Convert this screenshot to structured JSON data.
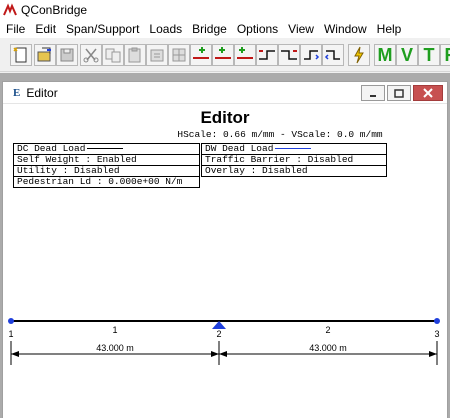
{
  "app": {
    "title": "QConBridge"
  },
  "menu": [
    "File",
    "Edit",
    "Span/Support",
    "Loads",
    "Bridge",
    "Options",
    "View",
    "Window",
    "Help"
  ],
  "toolbar": {
    "letters": [
      "M",
      "V",
      "T",
      "R"
    ]
  },
  "editor": {
    "window_title": "Editor",
    "heading": "Editor",
    "scale_text": "HScale: 0.66 m/mm - VScale: 0.0 m/mm",
    "legend_left": [
      "DC Dead Load",
      "Self Weight : Enabled",
      "Utility : Disabled",
      "Pedestrian Ld : 0.000e+00 N/m"
    ],
    "legend_right": [
      "DW Dead Load",
      "Traffic Barrier : Disabled",
      "Overlay : Disabled"
    ],
    "spans": [
      {
        "label": "1",
        "length": "43.000 m"
      },
      {
        "label": "2",
        "length": "43.000 m"
      }
    ],
    "supports": [
      "1",
      "2",
      "3"
    ]
  },
  "colors": {
    "dc_line": "#000000",
    "dw_line": "#1f3fdc",
    "support": "#1f3fdc",
    "close": "#c75050",
    "toolbar_letters": "#1f9e1f"
  }
}
